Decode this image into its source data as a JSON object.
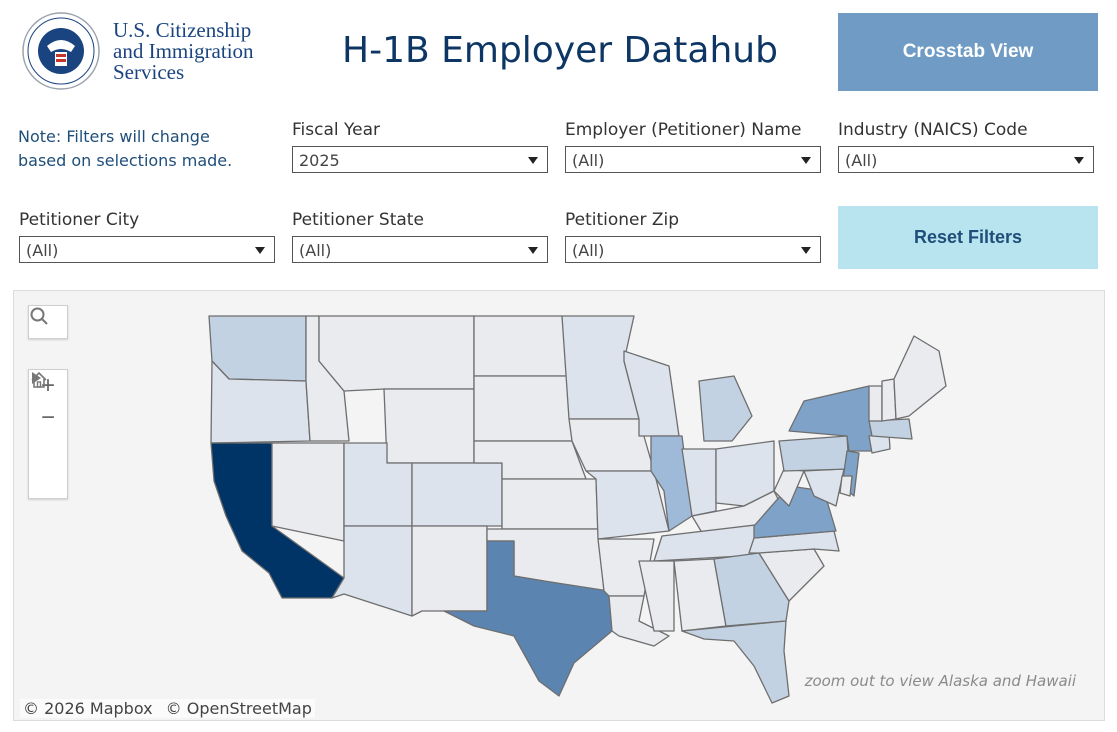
{
  "header": {
    "agency_lines": [
      "U.S. Citizenship",
      "and Immigration",
      "Services"
    ],
    "seal_icon": "dhs-seal-icon",
    "title": "H-1B Employer Datahub",
    "crosstab_label": "Crosstab View"
  },
  "note": "Note: Filters will change based on selections made.",
  "filters": {
    "fiscal_year": {
      "label": "Fiscal Year",
      "value": "2025"
    },
    "employer": {
      "label": "Employer (Petitioner) Name",
      "value": "(All)"
    },
    "industry": {
      "label": "Industry (NAICS) Code",
      "value": "(All)"
    },
    "city": {
      "label": "Petitioner City",
      "value": "(All)"
    },
    "state": {
      "label": "Petitioner State",
      "value": "(All)"
    },
    "zip": {
      "label": "Petitioner Zip",
      "value": "(All)"
    }
  },
  "reset_label": "Reset Filters",
  "map": {
    "hint": "zoom out to view Alaska and Hawaii",
    "attribution": [
      "© 2026 Mapbox",
      "© OpenStreetMap"
    ],
    "controls": [
      "search-icon",
      "zoom-in-icon",
      "zoom-out-icon",
      "home-icon",
      "play-icon"
    ],
    "colors": {
      "background": "#f4f4f4",
      "state_default": "#e9ebee",
      "state_border": "#6e6e6e",
      "highest": "#003366",
      "high": "#5b84b1",
      "mid": "#7fa2c8",
      "low_mid": "#9fbad8",
      "low": "#c3d2e3",
      "lowest": "#dce3ec"
    },
    "shaded_states": {
      "California": "highest",
      "Texas": "high",
      "New York": "mid",
      "New Jersey": "mid",
      "Virginia": "mid",
      "Illinois": "low_mid",
      "Washington": "low",
      "Massachusetts": "low",
      "Georgia": "low",
      "Florida": "low",
      "Michigan": "low",
      "Pennsylvania": "low",
      "North Carolina": "lowest",
      "Ohio": "lowest",
      "Arizona": "lowest",
      "Colorado": "lowest",
      "Minnesota": "lowest",
      "Maryland": "lowest",
      "Connecticut": "lowest",
      "Missouri": "lowest",
      "Wisconsin": "lowest",
      "Tennessee": "lowest",
      "Indiana": "lowest",
      "Oregon": "lowest",
      "Utah": "lowest"
    }
  }
}
